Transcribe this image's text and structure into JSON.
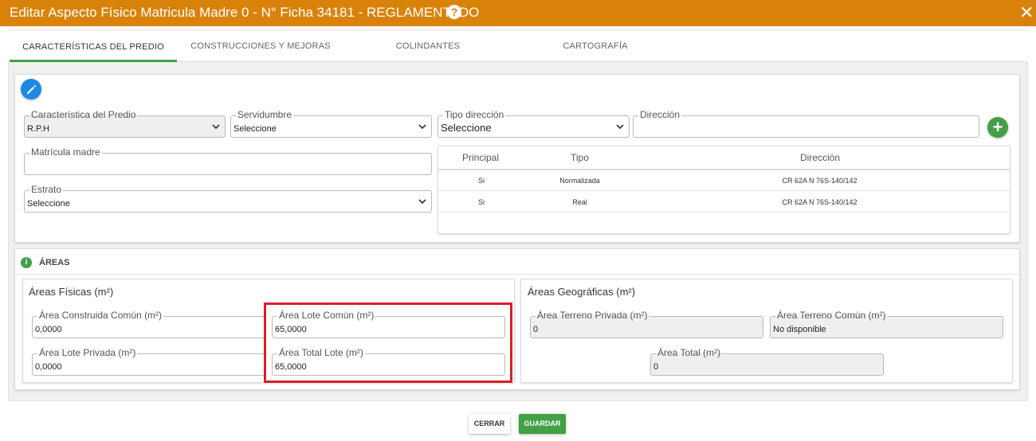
{
  "window": {
    "title": "Editar Aspecto Físico Matricula Madre 0 - N° Ficha 34181 - REGLAMENTADO",
    "help_icon": "question-icon",
    "close_icon": "close-icon"
  },
  "tabs": [
    {
      "label": "CARACTERÍSTICAS DEL PREDIO",
      "active": true
    },
    {
      "label": "CONSTRUCCIONES Y MEJORAS",
      "active": false
    },
    {
      "label": "COLINDANTES",
      "active": false
    },
    {
      "label": "CARTOGRAFÍA",
      "active": false
    }
  ],
  "predio": {
    "caracteristica": {
      "label": "Característica del Predio",
      "value": "R.P.H"
    },
    "servidumbre": {
      "label": "Servidumbre",
      "value": "Seleccione"
    },
    "tipo_direccion": {
      "label": "Tipo dirección",
      "value": "Seleccione"
    },
    "direccion": {
      "label": "Dirección",
      "value": ""
    },
    "matricula_madre": {
      "label": "Matrícula madre",
      "value": ""
    },
    "estrato": {
      "label": "Estrato",
      "value": "Seleccione"
    }
  },
  "direcciones_table": {
    "headers": [
      "Principal",
      "Tipo",
      "Dirección"
    ],
    "rows": [
      [
        "Si",
        "Normalizada",
        "CR 62A N 76S-140/142"
      ],
      [
        "Si",
        "Real",
        "CR 62A N 76S-140/142"
      ]
    ]
  },
  "areas": {
    "section_title": "ÁREAS",
    "fisicas": {
      "title": "Áreas Físicas (m²)",
      "construida_comun": {
        "label": "Área Construida Común (m²)",
        "value": "0,0000"
      },
      "lote_comun": {
        "label": "Área Lote Común (m²)",
        "value": "65,0000"
      },
      "lote_privada": {
        "label": "Área Lote Privada (m²)",
        "value": "0,0000"
      },
      "total_lote": {
        "label": "Área Total Lote (m²)",
        "value": "65,0000"
      }
    },
    "geograficas": {
      "title": "Áreas Geográficas (m²)",
      "terreno_privada": {
        "label": "Área Terreno Privada (m²)",
        "value": "0"
      },
      "terreno_comun": {
        "label": "Área Terreno Común (m²)",
        "value": "No disponible"
      },
      "total": {
        "label": "Área Total (m²)",
        "value": "0"
      }
    }
  },
  "footer": {
    "cerrar": "CERRAR",
    "guardar": "GUARDAR"
  },
  "colors": {
    "title_bar": "#d9820a",
    "accent_green": "#43a047",
    "edit_blue": "#1e88e5",
    "highlight_red": "#d6202a"
  }
}
